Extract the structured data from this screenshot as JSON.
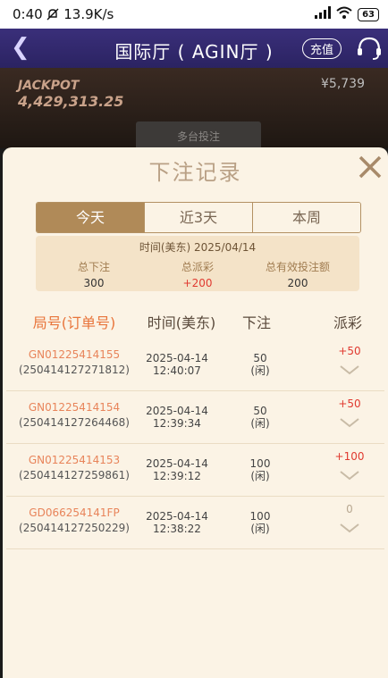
{
  "status": {
    "time": "0:40",
    "speed": "13.9K/s",
    "battery": "63"
  },
  "header": {
    "title": "国际厅 ( AGIN厅 )",
    "topup_label": "充值"
  },
  "background": {
    "jackpot_label": "JACKPOT",
    "jackpot_amount": "4,429,313.25",
    "balance": "¥5,739",
    "multi_table_label": "多台投注"
  },
  "modal": {
    "title": "下注记录",
    "tabs": [
      "今天",
      "近3天",
      "本周"
    ],
    "active_tab": "今天",
    "summary": {
      "date_label": "时间(美东)  2025/04/14",
      "total_bet_label": "总下注",
      "total_bet": "300",
      "total_payout_label": "总派彩",
      "total_payout": "+200",
      "valid_bet_label": "总有效投注额",
      "valid_bet": "200"
    },
    "columns": [
      "局号(订单号)",
      "时间(美东)",
      "下注",
      "派彩"
    ],
    "rows": [
      {
        "game_id": "GN01225414155",
        "order_no": "(250414127271812)",
        "date": "2025-04-14",
        "time": "12:40:07",
        "bet": "50",
        "bet_note": "(闲)",
        "payout": "+50"
      },
      {
        "game_id": "GN01225414154",
        "order_no": "(250414127264468)",
        "date": "2025-04-14",
        "time": "12:39:34",
        "bet": "50",
        "bet_note": "(闲)",
        "payout": "+50"
      },
      {
        "game_id": "GN01225414153",
        "order_no": "(250414127259861)",
        "date": "2025-04-14",
        "time": "12:39:12",
        "bet": "100",
        "bet_note": "(闲)",
        "payout": "+100"
      },
      {
        "game_id": "GD066254141FP",
        "order_no": "(250414127250229)",
        "date": "2025-04-14",
        "time": "12:38:22",
        "bet": "100",
        "bet_note": "(闲)",
        "payout": "0"
      }
    ]
  }
}
